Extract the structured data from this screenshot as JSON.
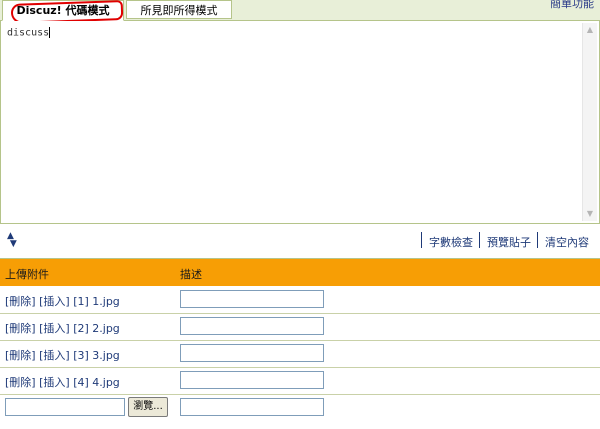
{
  "tabs": {
    "code_mode": "Discuz! 代碼模式",
    "wysiwyg_mode": "所見即所得模式",
    "simple_features": "簡單功能"
  },
  "editor": {
    "content": "discuss"
  },
  "toolbar": {
    "word_count": "字數檢查",
    "preview": "預覽貼子",
    "clear": "清空內容"
  },
  "attachments": {
    "header_upload": "上傳附件",
    "header_description": "描述",
    "rows": [
      {
        "delete": "[刪除]",
        "insert": "[插入]",
        "name": "[1] 1.jpg",
        "description": ""
      },
      {
        "delete": "[刪除]",
        "insert": "[插入]",
        "name": "[2] 2.jpg",
        "description": ""
      },
      {
        "delete": "[刪除]",
        "insert": "[插入]",
        "name": "[3] 3.jpg",
        "description": ""
      },
      {
        "delete": "[刪除]",
        "insert": "[插入]",
        "name": "[4] 4.jpg",
        "description": ""
      }
    ],
    "browse_label": "瀏覽...",
    "file_value": "",
    "new_description": ""
  },
  "colors": {
    "header_orange": "#f79e05",
    "link_blue": "#1f3a78",
    "border_green": "#b5c48a",
    "annotation_red": "#e00000"
  }
}
